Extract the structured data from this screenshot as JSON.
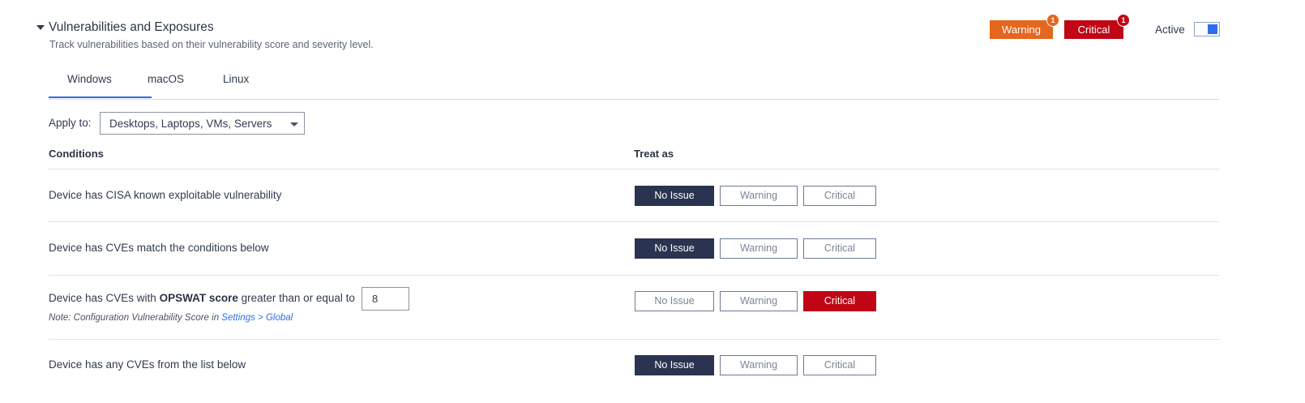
{
  "section": {
    "title": "Vulnerabilities and Exposures",
    "subtitle": "Track vulnerabilities based on their vulnerability score and severity level."
  },
  "header": {
    "warning_label": "Warning",
    "warning_count": "1",
    "critical_label": "Critical",
    "critical_count": "1",
    "active_label": "Active",
    "active_on": true
  },
  "tabs": [
    {
      "label": "Windows",
      "selected": true
    },
    {
      "label": "macOS",
      "selected": false
    },
    {
      "label": "Linux",
      "selected": false
    }
  ],
  "apply_to": {
    "label": "Apply to:",
    "value": "Desktops, Laptops, VMs, Servers"
  },
  "columns": {
    "conditions": "Conditions",
    "treat_as": "Treat as"
  },
  "options": {
    "no_issue": "No Issue",
    "warning": "Warning",
    "critical": "Critical"
  },
  "rows": [
    {
      "text": "Device has CISA known exploitable vulnerability",
      "selected": "No Issue"
    },
    {
      "text": "Device has CVEs match the conditions below",
      "selected": "No Issue"
    },
    {
      "text_before": "Device has CVEs with ",
      "text_bold": "OPSWAT score",
      "text_after": " greater than or equal to",
      "score_value": "8",
      "note_prefix": "Note: Configuration Vulnerability Score in ",
      "note_link": "Settings > Global",
      "selected": "Critical"
    },
    {
      "text": "Device has any CVEs from the list below",
      "selected": "No Issue"
    }
  ],
  "colors": {
    "warning": "#e5661e",
    "critical": "#c00615",
    "selected_dark": "#2a3450",
    "accent": "#2d6cf2"
  }
}
